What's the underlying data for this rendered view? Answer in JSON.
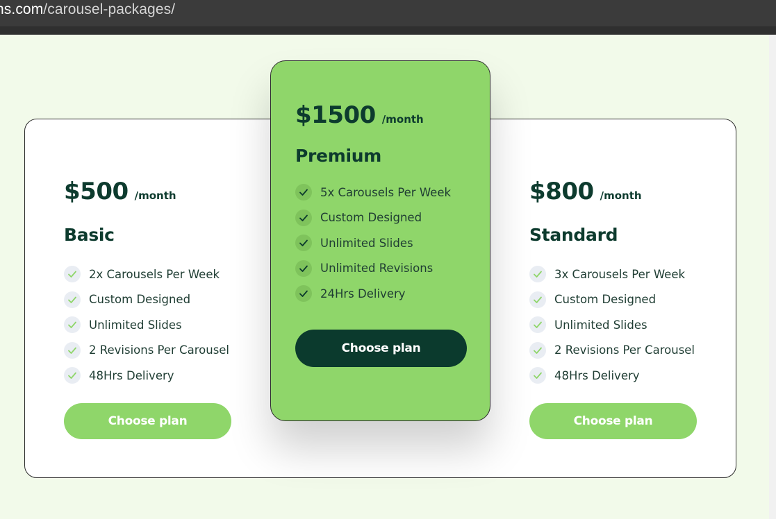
{
  "browser": {
    "url_domain": "ns.com",
    "url_path": "/carousel-packages/"
  },
  "colors": {
    "accent_green": "#8fd66a",
    "dark_green": "#0b3a2d",
    "page_bg": "#f2faea"
  },
  "plans": {
    "basic": {
      "price": "$500",
      "per": "/month",
      "name": "Basic",
      "features": [
        "2x Carousels Per Week",
        "Custom Designed",
        "Unlimited Slides",
        "2 Revisions Per Carousel",
        "48Hrs Delivery"
      ],
      "button": "Choose plan"
    },
    "premium": {
      "price": "$1500",
      "per": "/month",
      "name": "Premium",
      "features": [
        "5x Carousels Per Week",
        "Custom Designed",
        "Unlimited Slides",
        "Unlimited Revisions",
        "24Hrs Delivery"
      ],
      "button": "Choose plan"
    },
    "standard": {
      "price": "$800",
      "per": "/month",
      "name": "Standard",
      "features": [
        "3x Carousels Per Week",
        "Custom Designed",
        "Unlimited Slides",
        "2 Revisions Per Carousel",
        "48Hrs Delivery"
      ],
      "button": "Choose plan"
    }
  },
  "icons": {
    "feature_check": "check-icon"
  }
}
